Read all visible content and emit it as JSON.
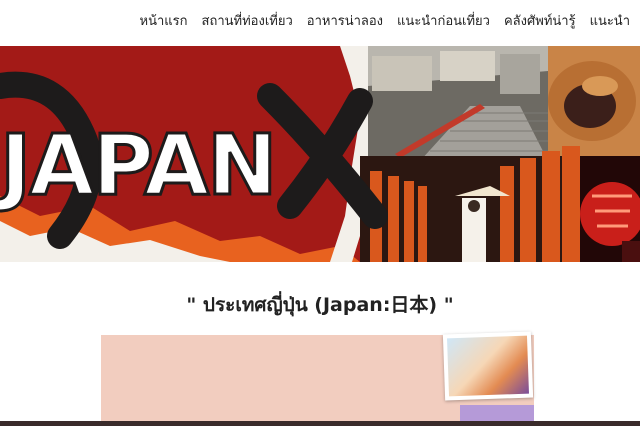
{
  "nav": {
    "items": [
      {
        "label": "หน้าแรก"
      },
      {
        "label": "สถานที่ท่องเที่ยว"
      },
      {
        "label": "อาหารน่าลอง"
      },
      {
        "label": "แนะนำก่อนเที่ยว"
      },
      {
        "label": "คลังศัพท์น่ารู้"
      },
      {
        "label": "แนะนำ"
      }
    ]
  },
  "hero": {
    "title": "JAPAN",
    "colors": {
      "red": "#a31a17",
      "orange": "#e8621f",
      "black": "#1d1b1b"
    }
  },
  "main": {
    "heading": "\" ประเทศญี่ปุ่น (Japan:日本) \""
  },
  "colors": {
    "panel": "#f2cdbf",
    "accent_purple": "#b59ad8"
  }
}
